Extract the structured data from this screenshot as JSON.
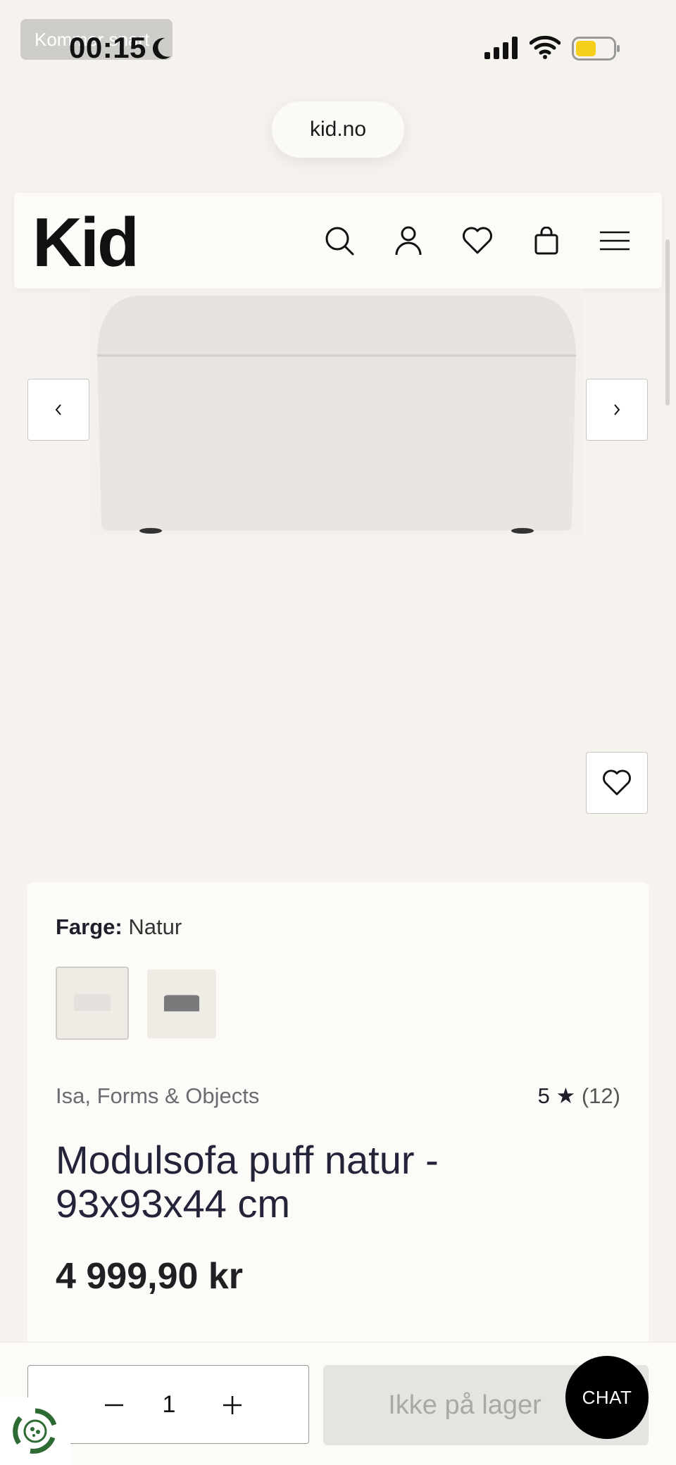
{
  "status_bar": {
    "toast": "Kommer snart",
    "time": "00:15"
  },
  "browser": {
    "url": "kid.no"
  },
  "header": {
    "logo": "Kid",
    "icons": [
      "search-icon",
      "user-icon",
      "heart-icon",
      "bag-icon",
      "menu-icon"
    ]
  },
  "gallery": {
    "prev_icon": "chevron-left-icon",
    "next_icon": "chevron-right-icon",
    "wishlist_icon": "heart-icon"
  },
  "product": {
    "color_label": "Farge:",
    "color_value": "Natur",
    "brand": "Isa, Forms & Objects",
    "rating": "5",
    "rating_count": "(12)",
    "title": "Modulsofa puff natur - 93x93x44 cm",
    "price": "4 999,90 kr"
  },
  "purchase": {
    "quantity": "1",
    "stock_label": "Ikke på lager",
    "chat_label": "CHAT"
  },
  "colors": {
    "background": "#f6f3ee",
    "card": "#fcfbf8",
    "battery": "#f6cf1a",
    "disabled_button": "#e6e4e1"
  }
}
